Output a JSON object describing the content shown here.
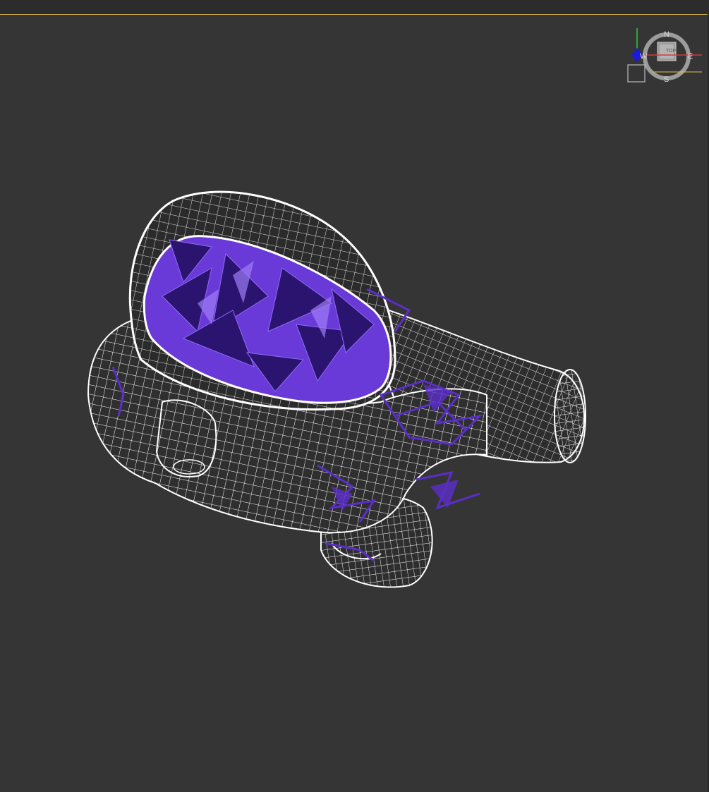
{
  "viewport": {
    "background": "#353535",
    "active_border_color": "#c8a64a"
  },
  "viewcube": {
    "face": "TOP",
    "compass": {
      "north": "N",
      "south": "S",
      "east": "E",
      "west": "W"
    },
    "icons": [
      "viewcube-icon",
      "world-axis-tripod-icon",
      "home-icon"
    ]
  },
  "model": {
    "wire_color": "#ffffff",
    "artifact_color": "#5b2ec9",
    "icon": "wireframe-mesh-icon"
  }
}
